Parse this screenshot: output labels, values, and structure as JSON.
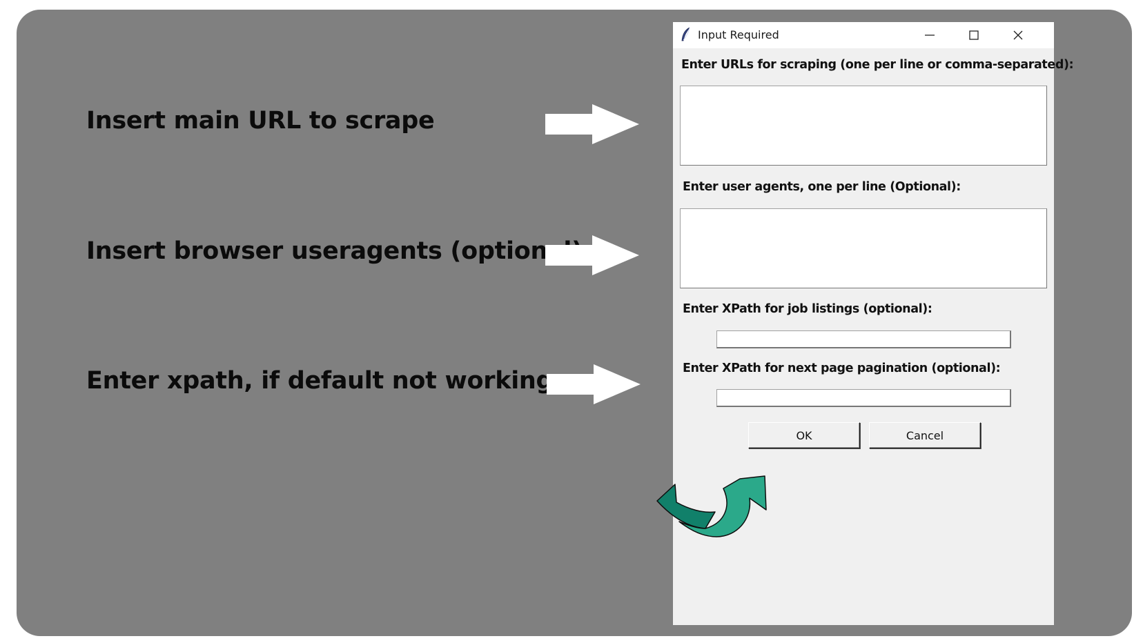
{
  "annotations": {
    "url_hint": "Insert main URL to scrape",
    "useragent_hint": "Insert browser useragents (optional)",
    "xpath_hint": "Enter xpath, if default not working"
  },
  "dialog": {
    "title": "Input Required",
    "icon": "feather-icon",
    "urls_label": "Enter URLs for scraping (one per line or comma-separated):",
    "urls_value": "",
    "useragents_label": "Enter user agents, one per line (Optional):",
    "useragents_value": "",
    "job_xpath_label": "Enter XPath for job listings (optional):",
    "job_xpath_value": "",
    "next_page_xpath_label": "Enter XPath for next page pagination (optional):",
    "next_page_xpath_value": "",
    "ok_label": "OK",
    "cancel_label": "Cancel"
  },
  "colors": {
    "panel_background": "#808080",
    "dialog_background": "#f0f0f0",
    "pointer_arrow": "#ffffff",
    "curved_arrow_dark": "#11806a",
    "curved_arrow_light": "#2ba98a"
  }
}
